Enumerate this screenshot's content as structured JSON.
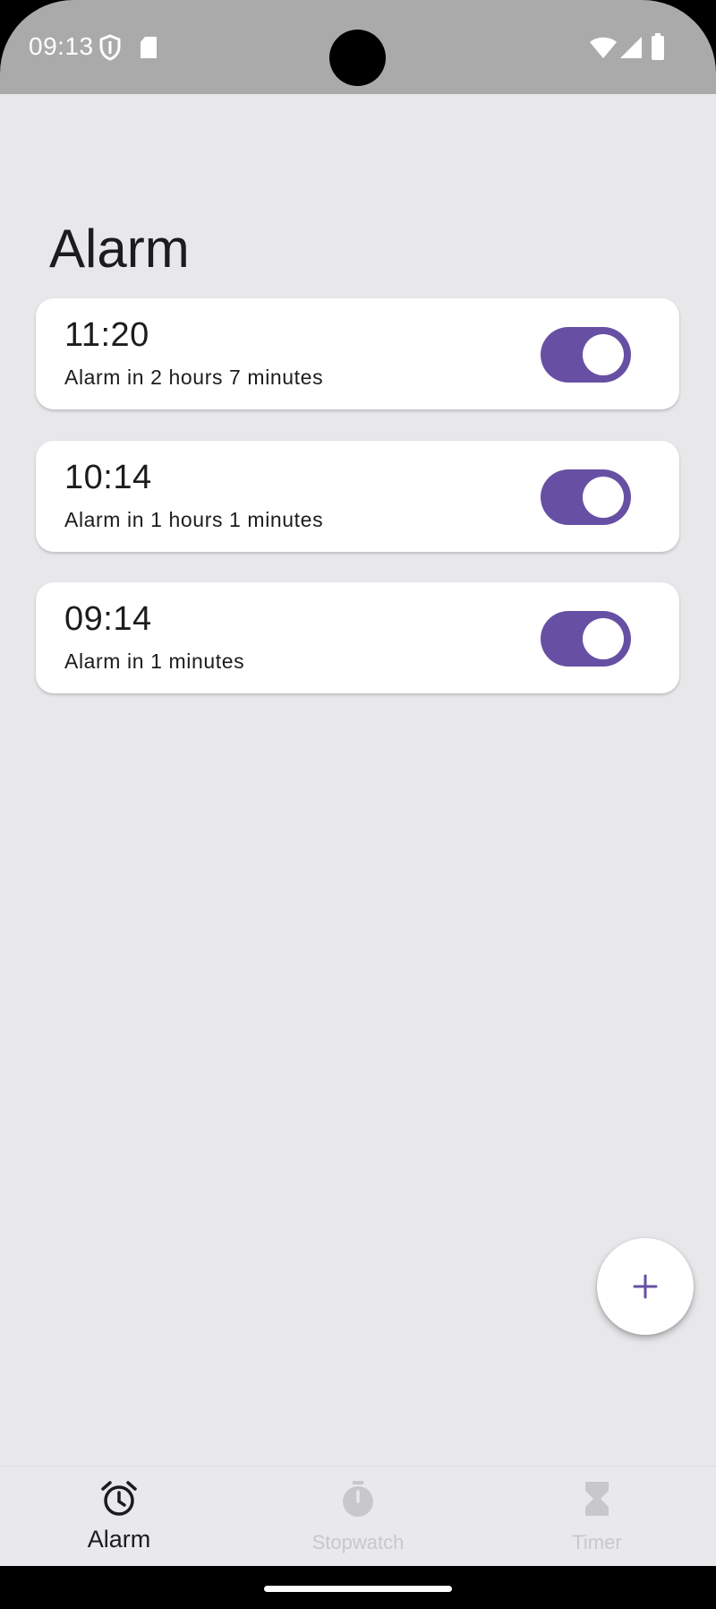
{
  "status_bar": {
    "time": "09:13",
    "icons": [
      "shield-icon",
      "sd-card-icon",
      "wifi-icon",
      "signal-icon",
      "battery-icon"
    ]
  },
  "page": {
    "title": "Alarm"
  },
  "alarms": [
    {
      "time": "11:20",
      "subtitle": "Alarm in 2 hours 7 minutes",
      "enabled": true
    },
    {
      "time": "10:14",
      "subtitle": "Alarm in 1 hours 1 minutes",
      "enabled": true
    },
    {
      "time": "09:14",
      "subtitle": "Alarm in 1 minutes",
      "enabled": true
    }
  ],
  "fab": {
    "icon": "plus-icon"
  },
  "bottom_nav": {
    "items": [
      {
        "label": "Alarm",
        "icon": "alarm-clock-icon",
        "active": true
      },
      {
        "label": "Stopwatch",
        "icon": "stopwatch-icon",
        "active": false
      },
      {
        "label": "Timer",
        "icon": "hourglass-icon",
        "active": false
      }
    ]
  },
  "colors": {
    "accent": "#6750a4",
    "background": "#e8e8eb",
    "card": "#ffffff",
    "status_bar": "#aaaaab",
    "text": "#1c1b1f",
    "inactive": "#c8c8cc"
  }
}
